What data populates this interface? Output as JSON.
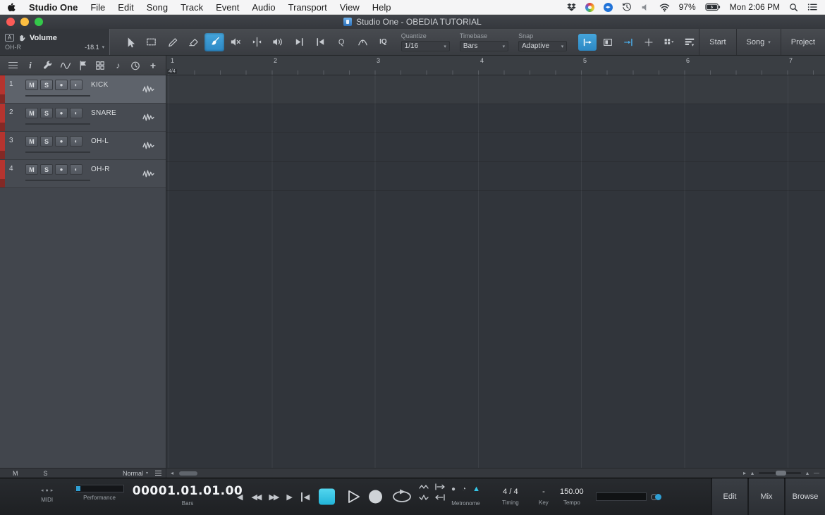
{
  "menubar": {
    "items": [
      "Studio One",
      "File",
      "Edit",
      "Song",
      "Track",
      "Event",
      "Audio",
      "Transport",
      "View",
      "Help"
    ],
    "battery": "97%",
    "clock": "Mon 2:06 PM"
  },
  "titlebar": {
    "title": "Studio One - OBEDIA TUTORIAL"
  },
  "toolbar": {
    "automation": {
      "badge": "A",
      "param": "Volume",
      "track": "OH-R",
      "value": "-18.1"
    },
    "q_label": "Q",
    "iq_label": "IQ",
    "quantize": {
      "label": "Quantize",
      "value": "1/16"
    },
    "timebase": {
      "label": "Timebase",
      "value": "Bars"
    },
    "snap": {
      "label": "Snap",
      "value": "Adaptive"
    },
    "start_button": "Start",
    "song_button": "Song",
    "project_button": "Project"
  },
  "ruler": {
    "meter": "4/4",
    "bars": [
      "1",
      "2",
      "3",
      "4",
      "5",
      "6",
      "7"
    ]
  },
  "tracks": {
    "mute_label": "M",
    "solo_label": "S",
    "rows": [
      {
        "num": "1",
        "name": "KICK"
      },
      {
        "num": "2",
        "name": "SNARE"
      },
      {
        "num": "3",
        "name": "OH-L"
      },
      {
        "num": "4",
        "name": "OH-R"
      }
    ]
  },
  "track_footer": {
    "mute": "M",
    "solo": "S",
    "mode": "Normal"
  },
  "transport": {
    "midi_label": "MIDI",
    "performance_label": "Performance",
    "time": "00001.01.01.00",
    "time_unit": "Bars",
    "metronome_label": "Metronome",
    "timing": {
      "value": "4 / 4",
      "label": "Timing"
    },
    "key": {
      "value": "-",
      "label": "Key"
    },
    "tempo": {
      "value": "150.00",
      "label": "Tempo"
    },
    "edit_button": "Edit",
    "mix_button": "Mix",
    "browse_button": "Browse"
  },
  "icons": {
    "dropdown": "▾",
    "monitor": "●",
    "input_monitor": "◐",
    "prev": "◀",
    "rewind": "◀◀",
    "forward": "▶▶",
    "next": "▶",
    "rtz": "◀",
    "metro_dot": "●",
    "metro_quarter": "◔",
    "metro_tri": "▲",
    "arrow_left_small": "◂",
    "arrow_right_small": "▸",
    "blue_badge_glyph": "◂▸",
    "midi_in": "◂",
    "midi_dot": "●",
    "midi_out": "▸",
    "zoom_tri": "▴",
    "zoom_dash": "—"
  }
}
